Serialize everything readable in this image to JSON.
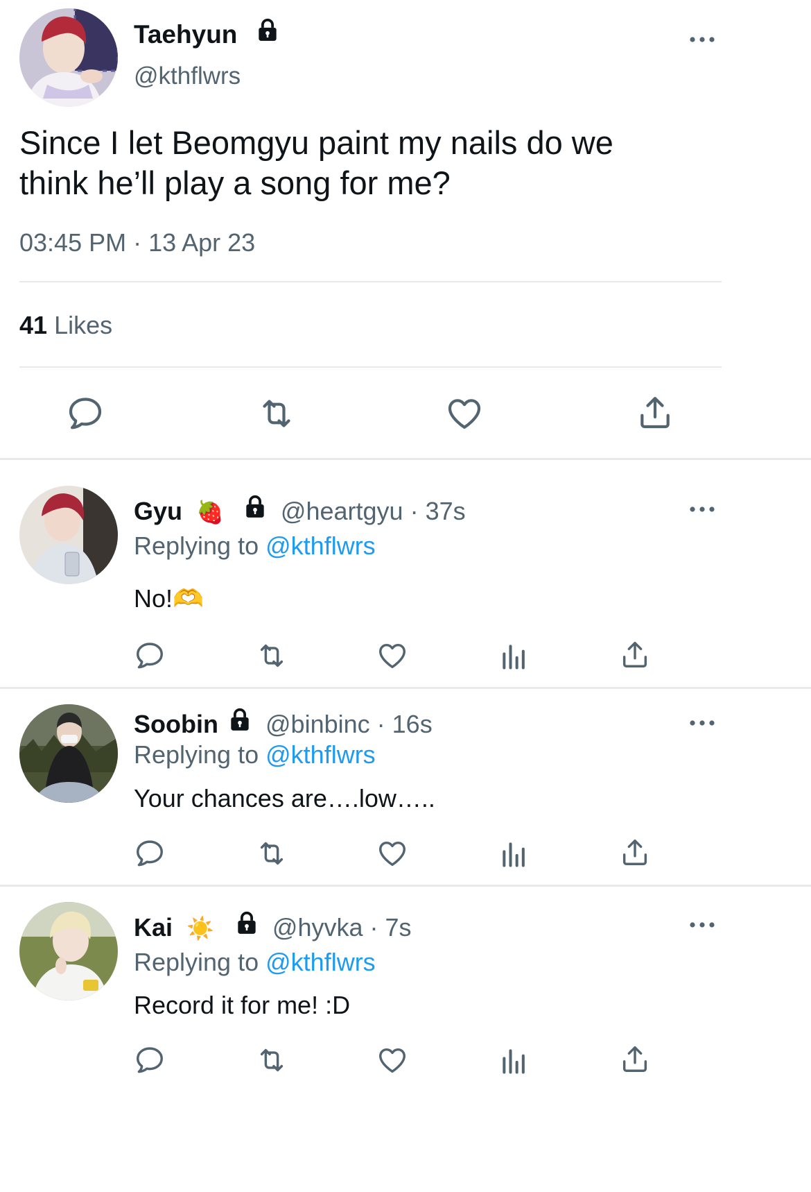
{
  "main_tweet": {
    "display_name": "Taehyun",
    "handle": "@kthflwrs",
    "avatar": "avatar-taehyun",
    "text_line1": "Since I let Beomgyu paint my nails do we",
    "text_line2": "think he’ll play a song for me?",
    "timestamp": "03:45 PM · 13 Apr 23",
    "likes_count": "41",
    "likes_label": "Likes",
    "icons": [
      "reply-icon",
      "retweet-icon",
      "like-icon",
      "share-icon"
    ]
  },
  "replies": [
    {
      "display_name": "Gyu",
      "emoji": "🍓",
      "handle": "@heartgyu",
      "time": "· 37s",
      "replying_prefix": "Replying to",
      "replying_to": "@kthflwrs",
      "text": "No!🫶"
    },
    {
      "display_name": "Soobin",
      "emoji": "",
      "handle": "@binbinc",
      "time": "· 16s",
      "replying_prefix": "Replying to",
      "replying_to": "@kthflwrs",
      "text": "Your chances are….low….."
    },
    {
      "display_name": "Kai",
      "emoji": "☀️",
      "handle": "@hyvka",
      "time": "· 7s",
      "replying_prefix": "Replying to",
      "replying_to": "@kthflwrs",
      "text": "Record it for me! :D"
    }
  ],
  "colors": {
    "accent": "#1d9bf0",
    "secondary_text": "#536471",
    "divider": "#e7e9eb"
  }
}
